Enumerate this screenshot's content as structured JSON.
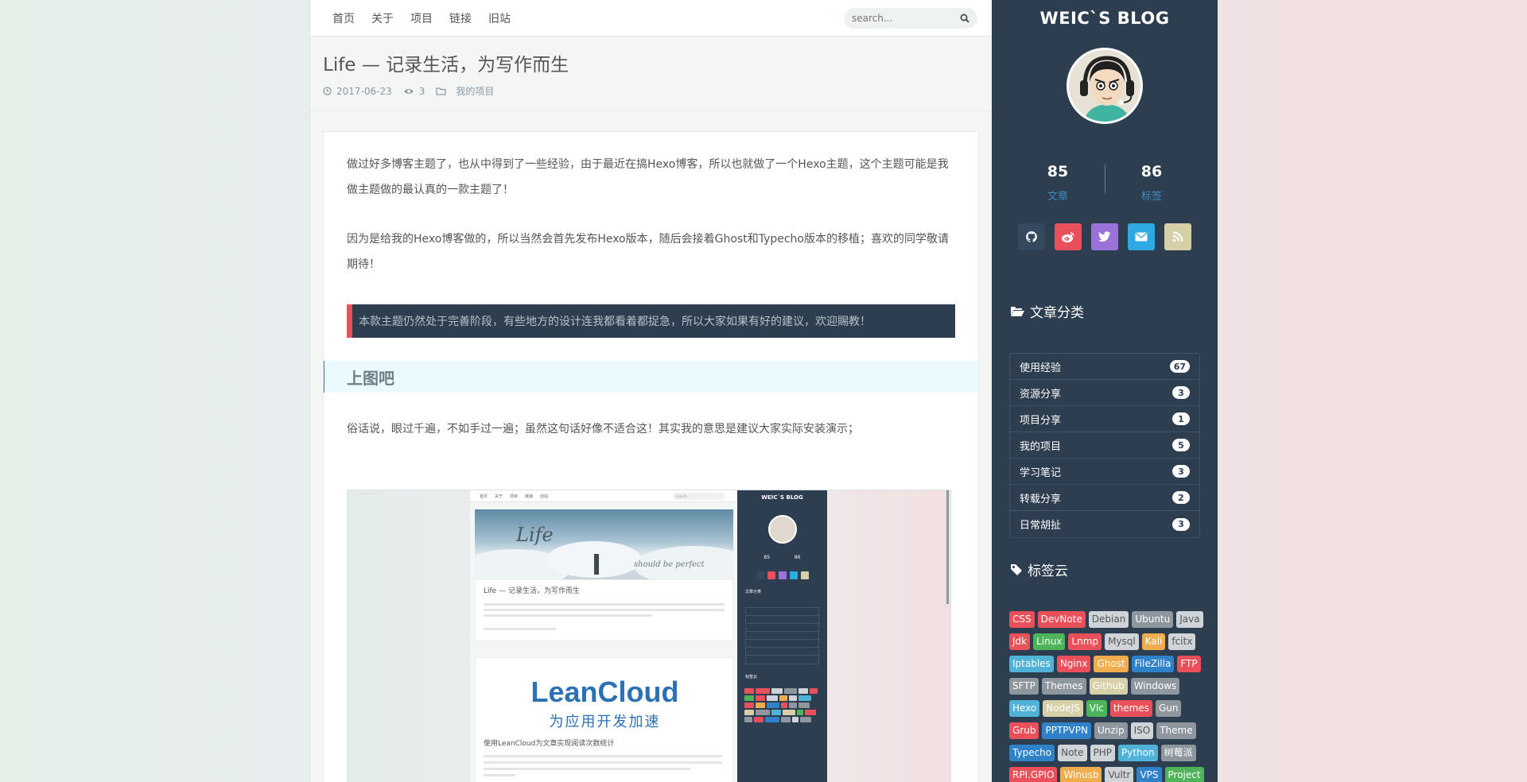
{
  "nav": {
    "items": [
      "首页",
      "关于",
      "项目",
      "链接",
      "旧站"
    ],
    "search_placeholder": "search..."
  },
  "post": {
    "title": "Life — 记录生活，为写作而生",
    "date": "2017-06-23",
    "views": "3",
    "category": "我的项目",
    "para1": "做过好多博客主题了，也从中得到了一些经验，由于最近在搞Hexo博客，所以也就做了一个Hexo主题，这个主题可能是我做主题做的最认真的一款主题了！",
    "para2": "因为是给我的Hexo博客做的，所以当然会首先发布Hexo版本，随后会接着Ghost和Typecho版本的移植；喜欢的同学敬请期待！",
    "notice": "本款主题仍然处于完善阶段，有些地方的设计连我都看着都捉急，所以大家如果有好的建议，欢迎賜教！",
    "section_title": "上图吧",
    "para3": "俗话说，眼过千遍，不如手过一遍；虽然这句话好像不适合这！其实我的意思是建议大家实际安装演示；"
  },
  "screenshot": {
    "nav_items": [
      "首页",
      "关于",
      "项目",
      "链接",
      "旧站"
    ],
    "search": "search...",
    "hero_word": "Life",
    "hero_sig": "should be perfect",
    "card1_title": "Life — 记录生活，为写作而生",
    "card2_logo": "LeanCloud",
    "card2_logo_sub": "为应用开发加速",
    "card2_title": "使用LeanCloud为文章实现阅读次数统计",
    "sidebar_title": "WEIC`S BLOG",
    "sidebar_nums": [
      "85",
      "86"
    ],
    "sidebar_cat": "文章分类",
    "sidebar_tags": "标签云"
  },
  "sidebar": {
    "blog_title": "WEIC`S BLOG",
    "posts_count": "85",
    "posts_label": "文章",
    "tags_count": "86",
    "tags_label": "标签",
    "social": [
      {
        "icon": "github-icon",
        "color": "#34495e"
      },
      {
        "icon": "weibo-icon",
        "color": "#e9505a"
      },
      {
        "icon": "twitter-icon",
        "color": "#9b73d8"
      },
      {
        "icon": "mail-icon",
        "color": "#2fa9e2"
      },
      {
        "icon": "rss-icon",
        "color": "#d6cfa8"
      }
    ],
    "categories_title": "文章分类",
    "categories": [
      {
        "name": "使用经验",
        "count": "67"
      },
      {
        "name": "资源分享",
        "count": "3"
      },
      {
        "name": "项目分享",
        "count": "1"
      },
      {
        "name": "我的项目",
        "count": "5"
      },
      {
        "name": "学习笔记",
        "count": "3"
      },
      {
        "name": "转载分享",
        "count": "2"
      },
      {
        "name": "日常胡扯",
        "count": "3"
      }
    ],
    "tagcloud_title": "标签云",
    "tags": [
      {
        "name": "CSS",
        "color": "#e9505a"
      },
      {
        "name": "DevNote",
        "color": "#e9505a"
      },
      {
        "name": "Debian",
        "color": "#cfd4d8",
        "text": "#555"
      },
      {
        "name": "Ubuntu",
        "color": "#8e979e"
      },
      {
        "name": "Java",
        "color": "#cfd4d8",
        "text": "#555"
      },
      {
        "name": "Jdk",
        "color": "#e9505a"
      },
      {
        "name": "Linux",
        "color": "#4db45a"
      },
      {
        "name": "Lnmp",
        "color": "#e9505a"
      },
      {
        "name": "Mysql",
        "color": "#cfd4d8",
        "text": "#555"
      },
      {
        "name": "Kali",
        "color": "#f0ad4e"
      },
      {
        "name": "fcitx",
        "color": "#cfd4d8",
        "text": "#555"
      },
      {
        "name": "Iptables",
        "color": "#4fb2d6"
      },
      {
        "name": "Nginx",
        "color": "#e9505a"
      },
      {
        "name": "Ghost",
        "color": "#f0ad4e"
      },
      {
        "name": "FileZilla",
        "color": "#2f82c8"
      },
      {
        "name": "FTP",
        "color": "#e9505a"
      },
      {
        "name": "SFTP",
        "color": "#8e979e"
      },
      {
        "name": "Themes",
        "color": "#8e979e"
      },
      {
        "name": "Github",
        "color": "#d6cfa8"
      },
      {
        "name": "Windows",
        "color": "#8e979e"
      },
      {
        "name": "Hexo",
        "color": "#4fb2d6"
      },
      {
        "name": "NodeJS",
        "color": "#d6cfa8"
      },
      {
        "name": "Vlc",
        "color": "#4db45a"
      },
      {
        "name": "themes",
        "color": "#e9505a"
      },
      {
        "name": "Gun",
        "color": "#8e979e"
      },
      {
        "name": "Grub",
        "color": "#e9505a"
      },
      {
        "name": "PPTPVPN",
        "color": "#2f82c8"
      },
      {
        "name": "Unzip",
        "color": "#8e979e"
      },
      {
        "name": "ISO",
        "color": "#cfd4d8",
        "text": "#555"
      },
      {
        "name": "Theme",
        "color": "#8e979e"
      },
      {
        "name": "Typecho",
        "color": "#2f82c8"
      },
      {
        "name": "Note",
        "color": "#cfd4d8",
        "text": "#555"
      },
      {
        "name": "PHP",
        "color": "#cfd4d8",
        "text": "#555"
      },
      {
        "name": "Python",
        "color": "#4fb2d6"
      },
      {
        "name": "树莓派",
        "color": "#8e979e"
      },
      {
        "name": "RPI.GPIO",
        "color": "#e9505a"
      },
      {
        "name": "Winusb",
        "color": "#f0ad4e"
      },
      {
        "name": "Vultr",
        "color": "#cfd4d8",
        "text": "#555"
      },
      {
        "name": "VPS",
        "color": "#2f82c8"
      },
      {
        "name": "Project",
        "color": "#4db45a"
      }
    ]
  }
}
